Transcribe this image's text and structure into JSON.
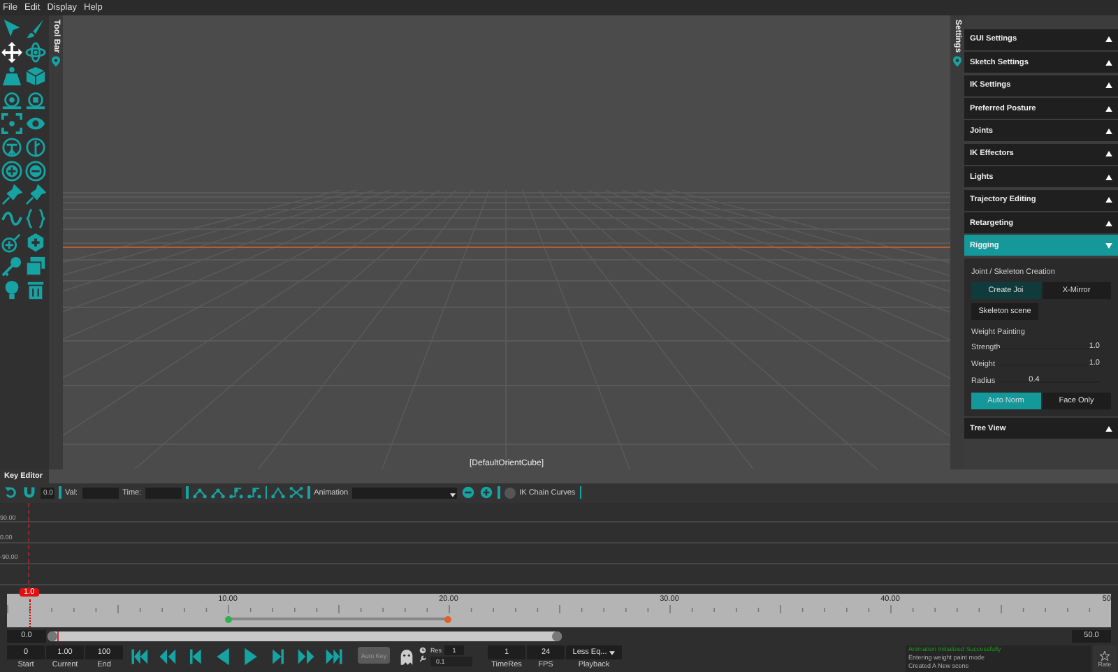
{
  "menu": [
    "File",
    "Edit",
    "Display",
    "Help"
  ],
  "toolbar_tab": {
    "label": "Tool Bar"
  },
  "viewport": {
    "object_label": "[DefaultOrientCube]"
  },
  "settings_tab": {
    "label": "Settings"
  },
  "settings": {
    "sections": [
      {
        "title": "GUI Settings",
        "expanded": false
      },
      {
        "title": "Sketch Settings",
        "expanded": false
      },
      {
        "title": "IK Settings",
        "expanded": false
      },
      {
        "title": "Preferred Posture",
        "expanded": false
      },
      {
        "title": "Joints",
        "expanded": false
      },
      {
        "title": "IK Effectors",
        "expanded": false
      },
      {
        "title": "Lights",
        "expanded": false
      },
      {
        "title": "Trajectory Editing",
        "expanded": false
      },
      {
        "title": "Retargeting",
        "expanded": false
      },
      {
        "title": "Rigging",
        "expanded": true
      },
      {
        "title": "Tree View",
        "expanded": false
      }
    ],
    "rigging": {
      "joint_heading": "Joint / Skeleton Creation",
      "joint_buttons": [
        {
          "label": "Create Joi",
          "selected": true
        },
        {
          "label": "X-Mirror",
          "selected": false
        }
      ],
      "scene_button": "Skeleton scene",
      "weight_heading": "Weight Painting",
      "sliders": [
        {
          "label": "Strength",
          "level": 1.0,
          "reading": "1.0"
        },
        {
          "label": "Weight",
          "level": 1.0,
          "reading": "1.0"
        },
        {
          "label": "Radius",
          "level": 0.4,
          "reading": "0.4"
        }
      ],
      "mode_buttons": [
        {
          "label": "Auto Norm",
          "selected": true
        },
        {
          "label": "Face Only",
          "selected": false
        }
      ]
    }
  },
  "key_editor": {
    "title": "Key Editor",
    "step": "0.0",
    "val_label": "Val:",
    "time_label": "Time:",
    "animation_label": "Animation",
    "ik_chain": {
      "label": "IK Chain Curves",
      "on": false
    },
    "y_labels": [
      "90.00",
      "0.00",
      "-90.00"
    ]
  },
  "timeline": {
    "playhead": "1.0",
    "ticks": [
      "10.00",
      "20.00",
      "30.00",
      "40.00",
      "50"
    ]
  },
  "scrub": {
    "start": "0.0",
    "end": "50.0",
    "level": 0.02
  },
  "controls": {
    "fields": [
      {
        "value": "0",
        "label": "Start"
      },
      {
        "value": "1.00",
        "label": "Current"
      },
      {
        "value": "100",
        "label": "End"
      }
    ],
    "auto_key": {
      "label": "Auto Key",
      "disabled": true
    },
    "res": {
      "label": "Res",
      "value": "1",
      "sub": "0.1"
    },
    "time_res": {
      "value": "1",
      "label": "TimeRes"
    },
    "fps": {
      "value": "24",
      "label": "FPS"
    },
    "playback": {
      "value": "Less Eq...",
      "label": "Playback"
    }
  },
  "log": [
    {
      "text": "Animation Initialized Successfully",
      "kind": "success"
    },
    {
      "text": "Entering weight paint mode",
      "kind": "info"
    },
    {
      "text": "Created A New scene",
      "kind": "info"
    }
  ],
  "rate": {
    "label": "Rate"
  }
}
